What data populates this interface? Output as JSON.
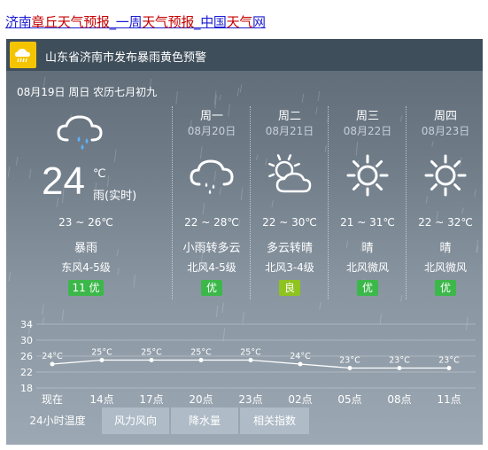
{
  "title": {
    "parts": [
      {
        "text": "济南",
        "hl": false
      },
      {
        "text": "章丘天气预报",
        "hl": true
      },
      {
        "text": "_一周",
        "hl": false
      },
      {
        "text": "天气预报",
        "hl": true
      },
      {
        "text": "_中国",
        "hl": false
      },
      {
        "text": "天气",
        "hl": true
      },
      {
        "text": "网",
        "hl": false
      }
    ]
  },
  "alert": {
    "text": "山东省济南市发布暴雨黄色预警",
    "color": "#f5c400"
  },
  "date_line": "08月19日 周日 农历七月初九",
  "today": {
    "temp": "24",
    "unit": "℃",
    "desc": "雨(实时)",
    "range": "23 ~ 26℃",
    "weather": "暴雨",
    "wind": "东风4-5级",
    "aqi": "11 优",
    "icon": "rain-cloud-icon"
  },
  "days": [
    {
      "week": "周一",
      "date": "08月20日",
      "icon": "rain-cloud-icon",
      "temp": "22 ~ 28℃",
      "weather": "小雨转多云",
      "wind": "北风4-5级",
      "aqi": "优",
      "aqi_level": "good"
    },
    {
      "week": "周二",
      "date": "08月21日",
      "icon": "partly-cloudy-icon",
      "temp": "22 ~ 30℃",
      "weather": "多云转晴",
      "wind": "北风3-4级",
      "aqi": "良",
      "aqi_level": "ok"
    },
    {
      "week": "周三",
      "date": "08月22日",
      "icon": "sun-icon",
      "temp": "21 ~ 31℃",
      "weather": "晴",
      "wind": "北风微风",
      "aqi": "优",
      "aqi_level": "good"
    },
    {
      "week": "周四",
      "date": "08月23日",
      "icon": "sun-icon",
      "temp": "22 ~ 32℃",
      "weather": "晴",
      "wind": "北风微风",
      "aqi": "优",
      "aqi_level": "good"
    }
  ],
  "chart_data": {
    "type": "line",
    "x": [
      "现在",
      "14点",
      "17点",
      "20点",
      "23点",
      "02点",
      "05点",
      "08点",
      "11点"
    ],
    "values": [
      24,
      25,
      25,
      25,
      25,
      24,
      23,
      23,
      23
    ],
    "labels": [
      "24°C",
      "25°C",
      "25°C",
      "25°C",
      "25°C",
      "24°C",
      "23°C",
      "23°C",
      "23°C"
    ],
    "yticks": [
      34,
      30,
      26,
      22,
      18
    ],
    "ylim": [
      18,
      34
    ],
    "grid": true
  },
  "tabs": [
    {
      "label": "24小时温度",
      "active": true
    },
    {
      "label": "风力风向",
      "active": false
    },
    {
      "label": "降水量",
      "active": false
    },
    {
      "label": "相关指数",
      "active": false
    }
  ],
  "colors": {
    "aqi_good": "#3cb84a",
    "aqi_ok": "#8fc31f",
    "title_link": "#1a1ad0",
    "title_highlight": "#c40000"
  }
}
